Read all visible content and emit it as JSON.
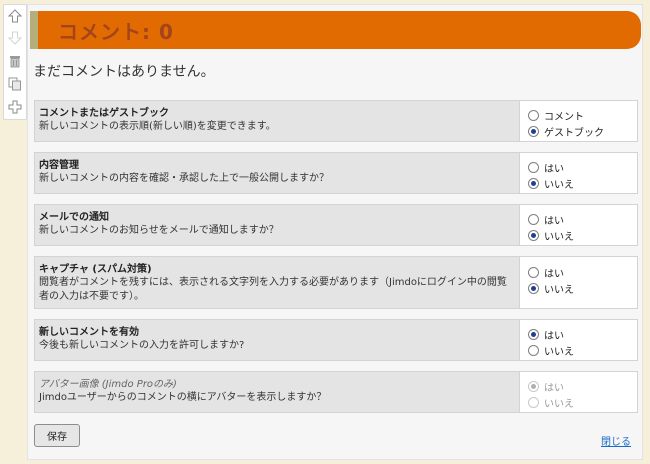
{
  "header": {
    "title": "コメント: 0"
  },
  "empty_message": "まだコメントはありません。",
  "settings": [
    {
      "title": "コメントまたはゲストブック",
      "description": "新しいコメントの表示順(新しい順)を変更できます。",
      "options": [
        "コメント",
        "ゲストブック"
      ],
      "selected": "ゲストブック",
      "disabled": false
    },
    {
      "title": "内容管理",
      "description": "新しいコメントの内容を確認・承認した上で一般公開しますか？",
      "options": [
        "はい",
        "いいえ"
      ],
      "selected": "いいえ",
      "disabled": false
    },
    {
      "title": "メールでの通知",
      "description": "新しいコメントのお知らせをメールで通知しますか？",
      "options": [
        "はい",
        "いいえ"
      ],
      "selected": "いいえ",
      "disabled": false
    },
    {
      "title": "キャプチャ (スパム対策)",
      "description": "閲覧者がコメントを残すには、表示される文字列を入力する必要があります（Jimdoにログイン中の閲覧者の入力は不要です）。",
      "options": [
        "はい",
        "いいえ"
      ],
      "selected": "いいえ",
      "disabled": false
    },
    {
      "title": "新しいコメントを有効",
      "description": "今後も新しいコメントの入力を許可しますか?",
      "options": [
        "はい",
        "いいえ"
      ],
      "selected": "はい",
      "disabled": false
    },
    {
      "title": "アバター画像 (Jimdo Proのみ)",
      "description": "Jimdoユーザーからのコメントの横にアバターを表示しますか？",
      "options": [
        "はい",
        "いいえ"
      ],
      "selected": "はい",
      "disabled": true
    }
  ],
  "save_label": "保存",
  "close_label": "閉じる",
  "toolbar_icons": [
    "arrow-up-icon",
    "arrow-down-icon",
    "trash-icon",
    "copy-icon",
    "plus-icon"
  ]
}
